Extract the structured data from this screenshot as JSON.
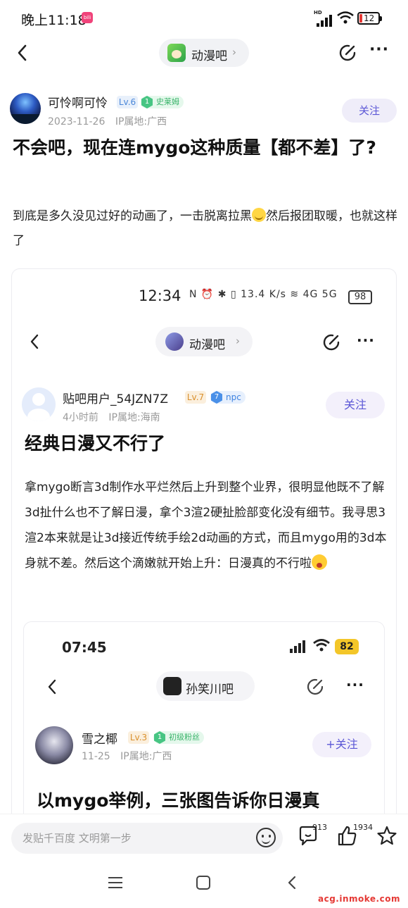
{
  "status_bar": {
    "time": "晚上11:18",
    "badge": "bili",
    "network": "HD",
    "battery": "12"
  },
  "top_nav": {
    "forum_name": "动漫吧"
  },
  "post": {
    "author": {
      "name": "可怜啊可怜",
      "level": "Lv.6",
      "title_badge": "史莱姆",
      "badge_level": "1",
      "date": "2023-11-26",
      "ip": "IP属地:广西"
    },
    "follow_label": "关注",
    "title": "不会吧，现在连mygo这种质量【都不差】了?",
    "body_part1": "到底是多久没见过好的动画了，一击脱离拉黑",
    "body_part2": "然后报团取暖，也就这样了"
  },
  "embedded_1": {
    "status": {
      "time": "12:34",
      "icons": "N ⏰ ✱ ▯ 13.4 K/s ≋ 4G 5G",
      "battery": "98"
    },
    "forum_name": "动漫吧",
    "author": {
      "name": "贴吧用户_54JZN7Z",
      "level": "Lv.7",
      "badge": "npc",
      "badge_level": "7",
      "time": "4小时前",
      "ip": "IP属地:海南"
    },
    "follow_label": "关注",
    "title": "经典日漫又不行了",
    "body": "拿mygo断言3d制作水平烂然后上升到整个业界，很明显他既不了解3d扯什么也不了解日漫，拿个3渲2硬扯脸部变化没有细节。我寻思3渲2本来就是让3d接近传统手绘2d动画的方式，而且mygo用的3d本身就不差。然后这个滴嫩就开始上升：日漫真的不行啦"
  },
  "embedded_2": {
    "status": {
      "time": "07:45",
      "battery": "82"
    },
    "forum_name": "孙笑川吧",
    "author": {
      "name": "雪之椰",
      "level": "Lv.3",
      "badge": "初级粉丝",
      "badge_level": "1",
      "date": "11-25",
      "ip": "IP属地:广西"
    },
    "follow_label": "+关注",
    "title": "以mygo举例，三张图告诉你日漫真"
  },
  "bottom_bar": {
    "reply_placeholder": "发贴千百度 文明第一步",
    "comments_count": "913",
    "likes_count": "1934"
  },
  "watermark": "acg.inmoke.com",
  "colors": {
    "accent": "#5b57d6",
    "follow_bg": "#efedf9",
    "badge_green": "#47c583",
    "watermark": "#e53935"
  }
}
